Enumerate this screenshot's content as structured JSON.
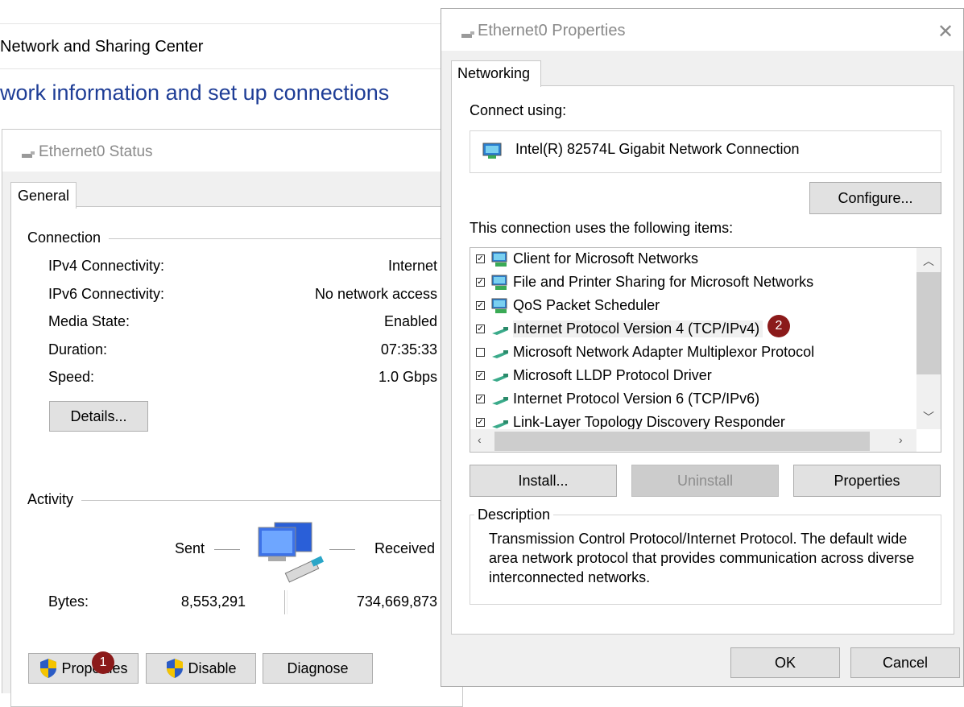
{
  "background_window": {
    "title": "Network and Sharing Center",
    "heading": "work information and set up connections"
  },
  "status_window": {
    "title": "Ethernet0 Status",
    "tab": "General",
    "connection_group": "Connection",
    "rows": [
      {
        "label": "IPv4 Connectivity:",
        "value": "Internet"
      },
      {
        "label": "IPv6 Connectivity:",
        "value": "No network access"
      },
      {
        "label": "Media State:",
        "value": "Enabled"
      },
      {
        "label": "Duration:",
        "value": "07:35:33"
      },
      {
        "label": "Speed:",
        "value": "1.0 Gbps"
      }
    ],
    "details_button": "Details...",
    "activity_group": "Activity",
    "sent_label": "Sent",
    "received_label": "Received",
    "bytes_label": "Bytes:",
    "bytes_sent": "8,553,291",
    "bytes_received": "734,669,873",
    "properties_button": "Properties",
    "disable_button": "Disable",
    "diagnose_button": "Diagnose",
    "badge": "1"
  },
  "properties_dialog": {
    "title": "Ethernet0 Properties",
    "close_icon": "close-icon",
    "tab": "Networking",
    "connect_using_label": "Connect using:",
    "adapter_name": "Intel(R) 82574L Gigabit Network Connection",
    "configure_button": "Configure...",
    "items_label": "This connection uses the following items:",
    "items": [
      {
        "label": "Client for Microsoft Networks",
        "checked": true,
        "icon": "network-client-icon"
      },
      {
        "label": "File and Printer Sharing for Microsoft Networks",
        "checked": true,
        "icon": "network-service-icon"
      },
      {
        "label": "QoS Packet Scheduler",
        "checked": true,
        "icon": "network-service-icon"
      },
      {
        "label": "Internet Protocol Version 4 (TCP/IPv4)",
        "checked": true,
        "icon": "network-protocol-icon",
        "selected": true
      },
      {
        "label": "Microsoft Network Adapter Multiplexor Protocol",
        "checked": false,
        "icon": "network-protocol-icon"
      },
      {
        "label": "Microsoft LLDP Protocol Driver",
        "checked": true,
        "icon": "network-protocol-icon"
      },
      {
        "label": "Internet Protocol Version 6 (TCP/IPv6)",
        "checked": true,
        "icon": "network-protocol-icon"
      },
      {
        "label": "Link-Layer Topology Discovery Responder",
        "checked": true,
        "icon": "network-protocol-icon"
      }
    ],
    "badge": "2",
    "install_button": "Install...",
    "uninstall_button": "Uninstall",
    "properties_button": "Properties",
    "description_label": "Description",
    "description_text": "Transmission Control Protocol/Internet Protocol. The default wide area network protocol that provides communication across diverse interconnected networks.",
    "ok_button": "OK",
    "cancel_button": "Cancel"
  },
  "colors": {
    "link_blue": "#1e3d96",
    "badge_red": "#8b1a1a",
    "dialog_bg": "#f0f0f0"
  }
}
